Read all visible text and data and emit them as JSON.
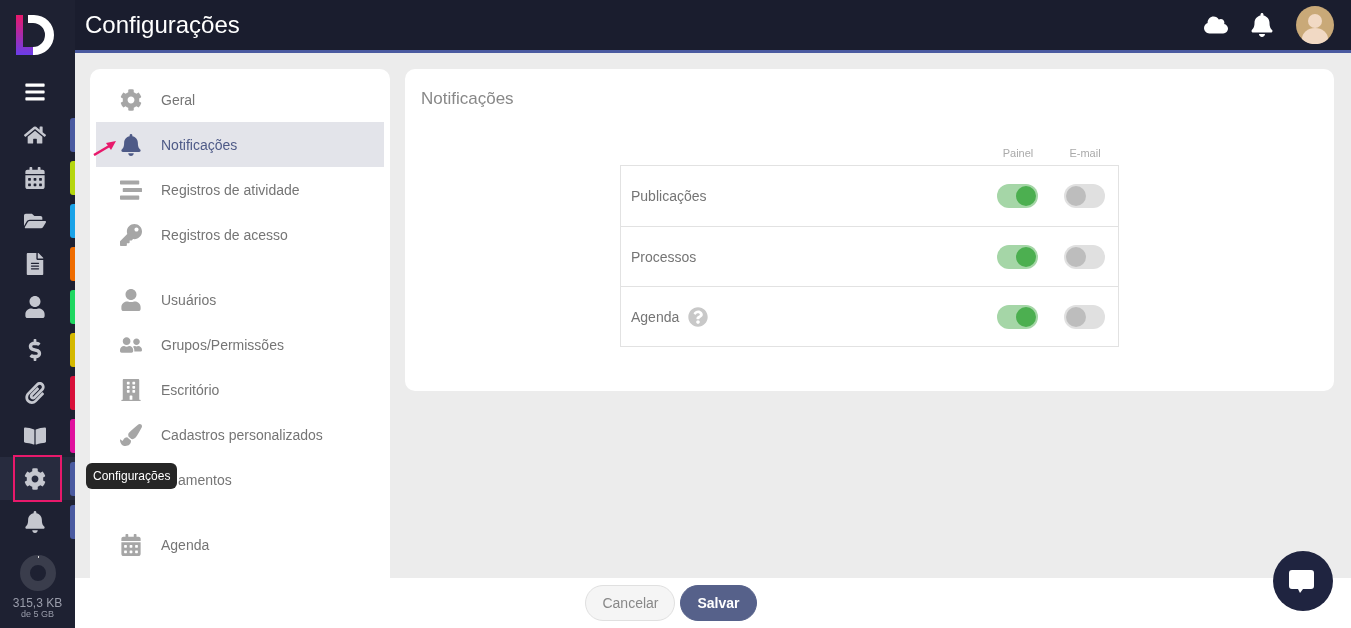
{
  "header": {
    "title": "Configurações"
  },
  "rail": {
    "items": [
      {
        "kind": "home",
        "color": "#4a5aa0",
        "selected": false
      },
      {
        "kind": "calendar",
        "color": "#b5d60f",
        "selected": false
      },
      {
        "kind": "folder",
        "color": "#1aa3e8",
        "selected": false
      },
      {
        "kind": "document",
        "color": "#ef6c00",
        "selected": false
      },
      {
        "kind": "person",
        "color": "#1ed760",
        "selected": false
      },
      {
        "kind": "dollar",
        "color": "#d4b800",
        "selected": false
      },
      {
        "kind": "clip",
        "color": "#d8103a",
        "selected": false
      },
      {
        "kind": "book",
        "color": "#e0109e",
        "selected": false
      },
      {
        "kind": "gear",
        "color": "#4a5aa0",
        "selected": true
      },
      {
        "kind": "bell",
        "color": "#4a5aa0",
        "selected": false
      }
    ],
    "tooltip": "Configurações",
    "storage": {
      "level": 0.01,
      "used": "315,3 KB",
      "total": "de 5 GB"
    }
  },
  "settings_menu": [
    [
      {
        "kind": "gear",
        "label": "Geral",
        "selected": false
      },
      {
        "kind": "bell",
        "label": "Notificações",
        "selected": true
      },
      {
        "kind": "lines",
        "label": "Registros de atividade",
        "selected": false
      },
      {
        "kind": "key",
        "label": "Registros de acesso",
        "selected": false
      }
    ],
    [
      {
        "kind": "user",
        "label": "Usuários",
        "selected": false
      },
      {
        "kind": "users",
        "label": "Grupos/Permissões",
        "selected": false
      },
      {
        "kind": "building",
        "label": "Escritório",
        "selected": false
      },
      {
        "kind": "brush",
        "label": "Cadastros personalizados",
        "selected": false
      },
      {
        "kind": "covered",
        "label": "amentos",
        "selected": false
      }
    ],
    [
      {
        "kind": "calendar",
        "label": "Agenda",
        "selected": false
      }
    ]
  ],
  "notifications": {
    "title": "Notificações",
    "columns": [
      "Painel",
      "E-mail"
    ],
    "rows": [
      {
        "label": "Publicações",
        "help": false,
        "panel": true,
        "email": false
      },
      {
        "label": "Processos",
        "help": false,
        "panel": true,
        "email": false
      },
      {
        "label": "Agenda",
        "help": true,
        "panel": true,
        "email": false
      }
    ]
  },
  "footer": {
    "buttons": [
      {
        "label": "Cancelar",
        "kind": "secondary"
      },
      {
        "label": "Salvar",
        "kind": "primary"
      }
    ]
  }
}
